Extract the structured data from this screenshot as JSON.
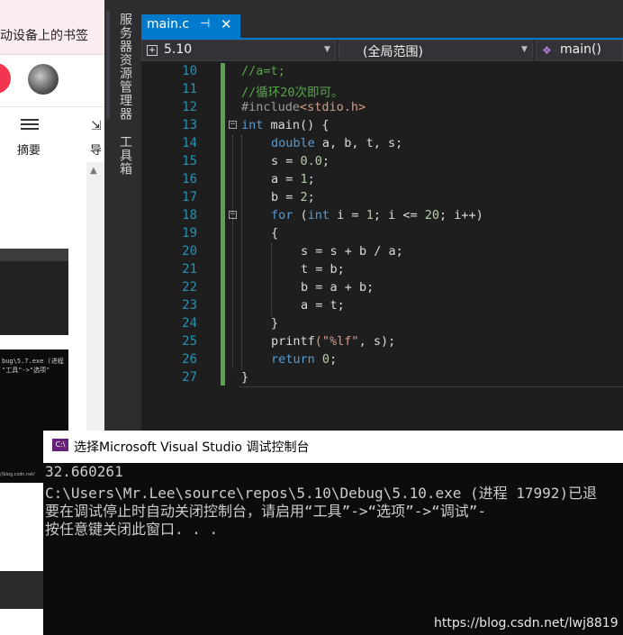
{
  "browser": {
    "bookmark_text": "动设备上的书签",
    "summary_label": "摘要",
    "nav_label": "导",
    "thumb_lines": [
      "bug\\5.7.exe (进程 1",
      "\"工具\"->\"选项\""
    ],
    "thumb_footer": "//blog.csdn.net/"
  },
  "sidebar": {
    "tabs": [
      "服务器资源管理器",
      "工具箱"
    ]
  },
  "editor": {
    "tab": {
      "title": "main.c",
      "pin": "⊣",
      "close": "✕"
    },
    "project": "5.10",
    "scope": "(全局范围)",
    "member": "main()",
    "lines": [
      {
        "num": "10",
        "indent": 0,
        "parts": [
          {
            "t": "//a=t;",
            "c": "cm"
          }
        ]
      },
      {
        "num": "11",
        "indent": 0,
        "parts": [
          {
            "t": "//循环20次即可。",
            "c": "cm"
          }
        ]
      },
      {
        "num": "12",
        "indent": 0,
        "parts": [
          {
            "t": "#include",
            "c": "pp"
          },
          {
            "t": "<stdio.h>",
            "c": "st"
          }
        ]
      },
      {
        "num": "13",
        "indent": 0,
        "fold": "−",
        "parts": [
          {
            "t": "int",
            "c": "kw"
          },
          {
            "t": " main() {",
            "c": ""
          }
        ]
      },
      {
        "num": "14",
        "indent": 1,
        "parts": [
          {
            "t": "double",
            "c": "kw"
          },
          {
            "t": " a, b, t, s;",
            "c": ""
          }
        ]
      },
      {
        "num": "15",
        "indent": 1,
        "parts": [
          {
            "t": "s = ",
            "c": ""
          },
          {
            "t": "0.0",
            "c": "nm"
          },
          {
            "t": ";",
            "c": ""
          }
        ]
      },
      {
        "num": "16",
        "indent": 1,
        "parts": [
          {
            "t": "a = ",
            "c": ""
          },
          {
            "t": "1",
            "c": "nm"
          },
          {
            "t": ";",
            "c": ""
          }
        ]
      },
      {
        "num": "17",
        "indent": 1,
        "parts": [
          {
            "t": "b = ",
            "c": ""
          },
          {
            "t": "2",
            "c": "nm"
          },
          {
            "t": ";",
            "c": ""
          }
        ]
      },
      {
        "num": "18",
        "indent": 1,
        "fold": "−",
        "parts": [
          {
            "t": "for",
            "c": "kw"
          },
          {
            "t": " (",
            "c": ""
          },
          {
            "t": "int",
            "c": "kw"
          },
          {
            "t": " i = ",
            "c": ""
          },
          {
            "t": "1",
            "c": "nm"
          },
          {
            "t": "; i <= ",
            "c": ""
          },
          {
            "t": "20",
            "c": "nm"
          },
          {
            "t": "; i++)",
            "c": ""
          }
        ]
      },
      {
        "num": "19",
        "indent": 1,
        "parts": [
          {
            "t": "{",
            "c": ""
          }
        ]
      },
      {
        "num": "20",
        "indent": 2,
        "parts": [
          {
            "t": "s = s + b / a;",
            "c": ""
          }
        ]
      },
      {
        "num": "21",
        "indent": 2,
        "parts": [
          {
            "t": "t = b;",
            "c": ""
          }
        ]
      },
      {
        "num": "22",
        "indent": 2,
        "parts": [
          {
            "t": "b = a + b;",
            "c": ""
          }
        ]
      },
      {
        "num": "23",
        "indent": 2,
        "parts": [
          {
            "t": "a = t;",
            "c": ""
          }
        ]
      },
      {
        "num": "24",
        "indent": 1,
        "parts": [
          {
            "t": "}",
            "c": ""
          }
        ]
      },
      {
        "num": "25",
        "indent": 1,
        "parts": [
          {
            "t": "printf",
            "c": ""
          },
          {
            "t": "(\"%lf\"",
            "c": "st"
          },
          {
            "t": ", s);",
            "c": ""
          }
        ]
      },
      {
        "num": "26",
        "indent": 1,
        "parts": [
          {
            "t": "return",
            "c": "kw"
          },
          {
            "t": " ",
            "c": ""
          },
          {
            "t": "0",
            "c": "nm"
          },
          {
            "t": ";",
            "c": ""
          }
        ]
      },
      {
        "num": "27",
        "indent": 0,
        "parts": [
          {
            "t": "}",
            "c": ""
          }
        ]
      }
    ]
  },
  "console": {
    "icon": "C:\\",
    "title": "选择Microsoft Visual Studio 调试控制台",
    "lines": [
      "32.660261",
      "C:\\Users\\Mr.Lee\\source\\repos\\5.10\\Debug\\5.10.exe (进程 17992)已退",
      "要在调试停止时自动关闭控制台，请启用“工具”->“选项”->“调试”-",
      "按任意键关闭此窗口. . ."
    ],
    "watermark": "https://blog.csdn.net/lwj8819"
  },
  "colors": {
    "accent": "#007acc",
    "keyword": "#569cd6",
    "comment": "#57a64a",
    "string": "#d69d85",
    "line_number": "#2b91af"
  }
}
